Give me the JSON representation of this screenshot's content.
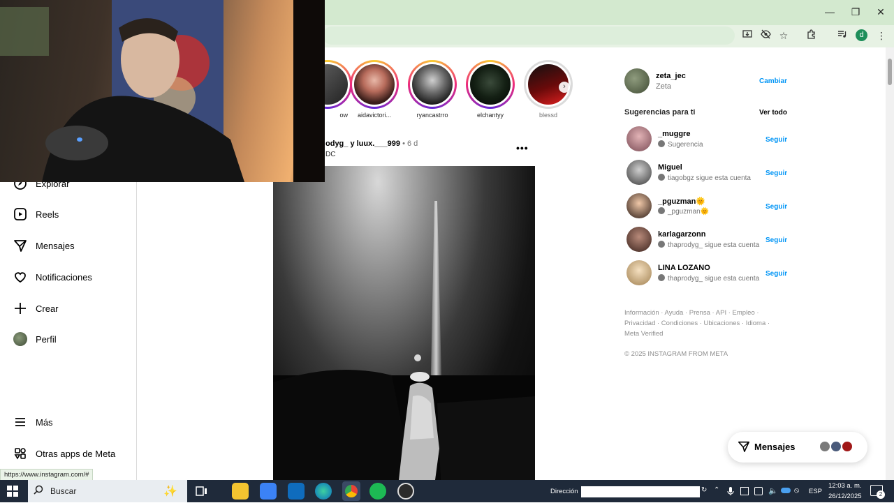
{
  "browser": {
    "window_controls": [
      "—",
      "❐",
      "✕"
    ],
    "profile_initial": "d",
    "status_url": "https://www.instagram.com/#"
  },
  "nav": {
    "items": [
      {
        "label": "Explorar",
        "icon": "compass-icon"
      },
      {
        "label": "Reels",
        "icon": "reels-icon"
      },
      {
        "label": "Mensajes",
        "icon": "messenger-icon"
      },
      {
        "label": "Notificaciones",
        "icon": "heart-icon"
      },
      {
        "label": "Crear",
        "icon": "plus-icon"
      },
      {
        "label": "Perfil",
        "icon": "profile-avatar"
      }
    ],
    "more_label": "Más",
    "meta_apps_label": "Otras apps de Meta"
  },
  "stories": [
    {
      "label": "ow",
      "seen": false
    },
    {
      "label": "aidavictori...",
      "seen": false
    },
    {
      "label": "ryancastrro",
      "seen": false
    },
    {
      "label": "elchantyy",
      "seen": false
    },
    {
      "label": "blessd",
      "seen": true
    }
  ],
  "post": {
    "author_line": "odyg_ y luux.___999",
    "time": "• 6 d",
    "location": "DC",
    "more": "•••"
  },
  "sidebar": {
    "current_user": {
      "username": "zeta_jec",
      "name": "Zeta",
      "switch_label": "Cambiar"
    },
    "suggestions_title": "Sugerencias para ti",
    "see_all": "Ver todo",
    "suggestions": [
      {
        "username": "_muggre",
        "reason": "Sugerencia",
        "action": "Seguir"
      },
      {
        "username": "Miguel",
        "reason": "tiagobgz sigue esta cuenta",
        "action": "Seguir"
      },
      {
        "username": "_pguzman🌞",
        "reason": "_pguzman🌞",
        "action": "Seguir"
      },
      {
        "username": "karlagarzonn",
        "reason": "thaprodyg_ sigue esta cuenta",
        "action": "Seguir"
      },
      {
        "username": "LINA LOZANO",
        "reason": "thaprodyg_ sigue esta cuenta",
        "action": "Seguir"
      }
    ],
    "footer_line1": "Información · Ayuda · Prensa · API · Empleo ·",
    "footer_line2": "Privacidad · Condiciones · Ubicaciones · Idioma ·",
    "footer_line3": "Meta Verified",
    "copyright": "© 2025 INSTAGRAM FROM META"
  },
  "messages_pill": {
    "label": "Mensajes"
  },
  "taskbar": {
    "search_placeholder": "Buscar",
    "address_label": "Dirección",
    "language": "ESP",
    "time": "12:03 a. m.",
    "date": "26/12/2025",
    "notifications": "2"
  },
  "colors": {
    "chrome_frame": "#d3e9cf",
    "link_blue": "#0095f6",
    "taskbar": "#1f2a3a"
  }
}
